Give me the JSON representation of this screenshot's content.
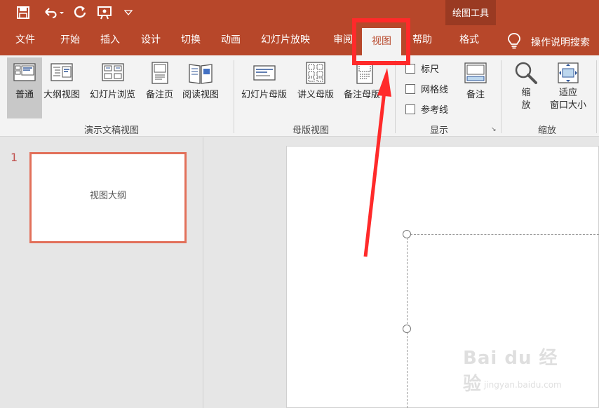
{
  "title_bar": {
    "qat": [
      {
        "name": "save-icon",
        "glyph": "💾"
      },
      {
        "name": "undo-icon",
        "glyph": "↶"
      },
      {
        "name": "redo-icon",
        "glyph": "↻"
      },
      {
        "name": "present-icon",
        "glyph": "▭"
      },
      {
        "name": "customize-qat-icon",
        "glyph": "▿"
      }
    ],
    "context_tool": "绘图工具"
  },
  "tabs": [
    "文件",
    "开始",
    "插入",
    "设计",
    "切换",
    "动画",
    "幻灯片放映",
    "审阅",
    "视图",
    "帮助",
    "格式"
  ],
  "active_tab": "视图",
  "tell_me": "操作说明搜索",
  "ribbon": {
    "presentation_views": {
      "label": "演示文稿视图",
      "buttons": [
        "普通",
        "大纲视图",
        "幻灯片浏览",
        "备注页",
        "阅读视图"
      ],
      "selected": "普通"
    },
    "master_views": {
      "label": "母版视图",
      "buttons": [
        "幻灯片母版",
        "讲义母版",
        "备注母版"
      ]
    },
    "show": {
      "label": "显示",
      "checkboxes": [
        {
          "label": "标尺",
          "checked": false
        },
        {
          "label": "网格线",
          "checked": false
        },
        {
          "label": "参考线",
          "checked": false
        }
      ],
      "notes_button": "备注"
    },
    "zoom": {
      "label": "缩放",
      "zoom_button": [
        "缩",
        "放"
      ],
      "fit_button": [
        "适应",
        "窗口大小"
      ]
    }
  },
  "slides": [
    {
      "number": "1",
      "text": "视图大纲"
    }
  ],
  "watermark": {
    "main": "Bai du 经验",
    "sub": "jingyan.baidu.com"
  },
  "colors": {
    "accent": "#b7472a",
    "context": "#9a3a22",
    "annotation": "#ff2a2a",
    "thumb_border": "#e2705a"
  }
}
